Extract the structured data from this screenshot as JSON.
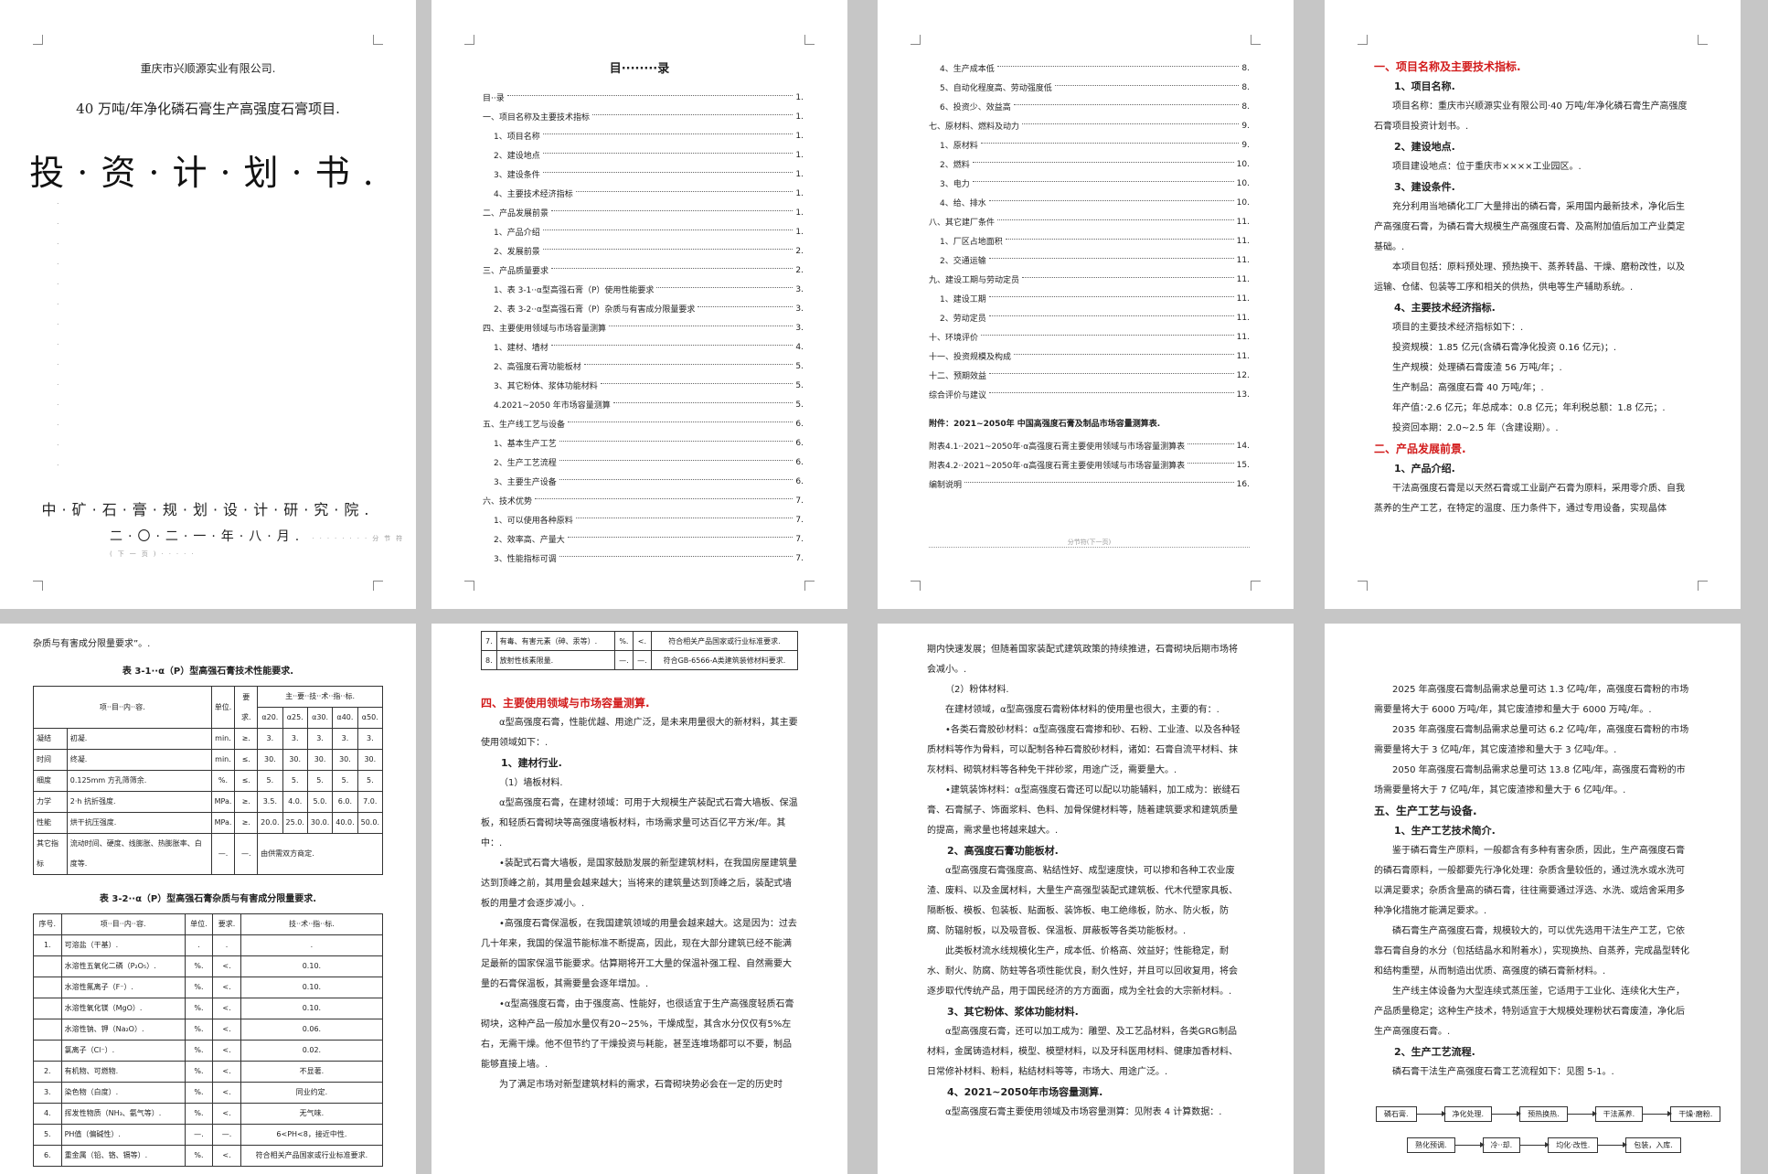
{
  "cover": {
    "company": "重庆市兴顺源实业有限公司.",
    "project": "40 万吨/年净化磷石膏生产高强度石膏项目.",
    "title": "投·资·计·划·书.",
    "institute": "中·矿·石·膏·规·划·设·计·研·究·院.",
    "date": "二·〇·二·一·年·八·月.",
    "section_break": "分节符(下一页)"
  },
  "toc": {
    "heading": "目········录",
    "page2_rows": [
      {
        "label": "目··录",
        "page": "1."
      },
      {
        "label": "一、项目名称及主要技术指标",
        "page": "1."
      },
      {
        "label": "1、项目名称",
        "page": "1."
      },
      {
        "label": "2、建设地点",
        "page": "1."
      },
      {
        "label": "3、建设条件",
        "page": "1."
      },
      {
        "label": "4、主要技术经济指标",
        "page": "1."
      },
      {
        "label": "二、产品发展前景",
        "page": "1."
      },
      {
        "label": "1、产品介绍",
        "page": "1."
      },
      {
        "label": "2、发展前景",
        "page": "2."
      },
      {
        "label": "三、产品质量要求",
        "page": "2."
      },
      {
        "label": "1、表 3-1··α型高强石膏（P）使用性能要求",
        "page": "3."
      },
      {
        "label": "2、表 3-2··α型高强石膏（P）杂质与有害成分限量要求",
        "page": "3."
      },
      {
        "label": "四、主要使用领域与市场容量测算",
        "page": "3."
      },
      {
        "label": "1、建材、墙材",
        "page": "4."
      },
      {
        "label": "2、高强度石膏功能板材",
        "page": "5."
      },
      {
        "label": "3、其它粉体、浆体功能材料",
        "page": "5."
      },
      {
        "label": "4.2021~2050 年市场容量测算",
        "page": "5."
      },
      {
        "label": "五、生产线工艺与设备",
        "page": "6."
      },
      {
        "label": "1、基本生产工艺",
        "page": "6."
      },
      {
        "label": "2、生产工艺流程",
        "page": "6."
      },
      {
        "label": "3、主要生产设备",
        "page": "6."
      },
      {
        "label": "六、技术优势",
        "page": "7."
      },
      {
        "label": "1、可以使用各种原料",
        "page": "7."
      },
      {
        "label": "2、效率高、产量大",
        "page": "7."
      },
      {
        "label": "3、性能指标可调",
        "page": "7."
      }
    ],
    "page3_rows": [
      {
        "label": "4、生产成本低",
        "page": "8."
      },
      {
        "label": "5、自动化程度高、劳动强度低",
        "page": "8."
      },
      {
        "label": "6、投资少、效益高",
        "page": "8."
      },
      {
        "label": "七、原材料、燃料及动力",
        "page": "9."
      },
      {
        "label": "1、原材料",
        "page": "9."
      },
      {
        "label": "2、燃料",
        "page": "10."
      },
      {
        "label": "3、电力",
        "page": "10."
      },
      {
        "label": "4、给、排水",
        "page": "10."
      },
      {
        "label": "八、其它建厂条件",
        "page": "11."
      },
      {
        "label": "1、厂区占地面积",
        "page": "11."
      },
      {
        "label": "2、交通运输",
        "page": "11."
      },
      {
        "label": "九、建设工期与劳动定员",
        "page": "11."
      },
      {
        "label": "1、建设工期",
        "page": "11."
      },
      {
        "label": "2、劳动定员",
        "page": "11."
      },
      {
        "label": "十、环境评价",
        "page": "11."
      },
      {
        "label": "十一、投资规模及构成",
        "page": "11."
      },
      {
        "label": "十二、预期效益",
        "page": "12."
      },
      {
        "label": "综合评价与建议",
        "page": "13."
      }
    ],
    "appendix_title": "附件：2021~2050年 中国高强度石膏及制品市场容量测算表.",
    "appendix_rows": [
      {
        "label": "附表4.1··2021~2050年·α高强度石膏主要使用领域与市场容量测算表",
        "page": "14."
      },
      {
        "label": "附表4.2··2021~2050年·α高强度石膏主要使用领域与市场容量测算表",
        "page": "15."
      },
      {
        "label": "编制说明",
        "page": "16."
      }
    ],
    "section_break": "分节符(下一页)"
  },
  "page4": {
    "h1": "一、项目名称及主要技术指标.",
    "s1": "1、项目名称.",
    "p1": "项目名称：重庆市兴顺源实业有限公司·40 万吨/年净化磷石膏生产高强度石膏项目投资计划书。.",
    "s2": "2、建设地点.",
    "p2": "项目建设地点：位于重庆市××××工业园区。.",
    "s3": "3、建设条件.",
    "p3": "充分利用当地磷化工厂大量排出的磷石膏，采用国内最新技术，净化后生产高强度石膏，为磷石膏大规模生产高强度石膏、及高附加值后加工产业奠定基础。.",
    "p4": "本项目包括：原料预处理、预热换干、蒸养转晶、干燥、磨粉改性，以及运输、仓储、包装等工序和相关的供热，供电等生产辅助系统。.",
    "s4": "4、主要技术经济指标.",
    "p5": "项目的主要技术经济指标如下：.",
    "l1": "投资规模：1.85 亿元(含磷石膏净化投资 0.16 亿元)；.",
    "l2": "生产规模：处理磷石膏废渣 56 万吨/年；.",
    "l3": "生产制品：高强度石膏 40 万吨/年；.",
    "l4": "年产值：·2.6 亿元；年总成本：0.8 亿元；年利税总额：1.8 亿元；.",
    "l5": "投资回本期：2.0~2.5 年（含建设期）。.",
    "h2": "二、产品发展前景.",
    "s5": "1、产品介绍.",
    "p6": "干法高强度石膏是以天然石膏或工业副产石膏为原料，采用零介质、自我蒸养的生产工艺，在特定的温度、压力条件下，通过专用设备，实现晶体"
  },
  "page5": {
    "intro": "杂质与有害成分限量要求”。.",
    "t1_title": "表 3-1··α（P）型高强石膏技术性能要求.",
    "t1_head": [
      "项··目··内··容.",
      "单位.",
      "要求.",
      "主··要··技··术··指··标."
    ],
    "t1_grades": [
      "α20.",
      "α25.",
      "α30.",
      "α40.",
      "α50."
    ],
    "t1_rows": [
      {
        "g": "凝结",
        "item": "初凝.",
        "unit": "min.",
        "req": "≥.",
        "v": [
          "3.",
          "3.",
          "3.",
          "3.",
          "3."
        ]
      },
      {
        "g": "时间",
        "item": "终凝.",
        "unit": "min.",
        "req": "≤.",
        "v": [
          "30.",
          "30.",
          "30.",
          "30.",
          "30."
        ]
      },
      {
        "g": "细度",
        "item": "0.125mm 方孔筛筛余.",
        "unit": "%.",
        "req": "≤.",
        "v": [
          "5.",
          "5.",
          "5.",
          "5.",
          "5."
        ]
      },
      {
        "g": "力学",
        "item": "2·h 抗折强度.",
        "unit": "MPa.",
        "req": "≥.",
        "v": [
          "3.5.",
          "4.0.",
          "5.0.",
          "6.0.",
          "7.0."
        ]
      },
      {
        "g": "性能",
        "item": "烘干抗压强度.",
        "unit": "MPa.",
        "req": "≥.",
        "v": [
          "20.0.",
          "25.0.",
          "30.0.",
          "40.0.",
          "50.0."
        ]
      },
      {
        "g": "其它指标",
        "item": "流动时间、硬度、线膨胀、热膨胀率、白度等.",
        "unit": "—.",
        "req": "—.",
        "v": [
          "由供需双方商定."
        ]
      }
    ],
    "t2_title": "表 3-2··α（P）型高强石膏杂质与有害成分限量要求.",
    "t2_head": [
      "序号.",
      "项··目··内··容.",
      "单位.",
      "要求.",
      "技··术··指··标."
    ],
    "t2_rows": [
      {
        "n": "1.",
        "item": "可溶盐（干基）.",
        "unit": ".",
        "req": ".",
        "val": "."
      },
      {
        "n": "",
        "item": "水溶性五氧化二磷（P₂O₅）.",
        "unit": "%.",
        "req": "<.",
        "val": "0.10."
      },
      {
        "n": "",
        "item": "水溶性氟离子（F⁻）.",
        "unit": "%.",
        "req": "<.",
        "val": "0.10."
      },
      {
        "n": "",
        "item": "水溶性氧化镁（MgO）.",
        "unit": "%.",
        "req": "<.",
        "val": "0.10."
      },
      {
        "n": "",
        "item": "水溶性钠、钾（Na₂O）.",
        "unit": "%.",
        "req": "<.",
        "val": "0.06."
      },
      {
        "n": "",
        "item": "氯离子（Cl⁻）.",
        "unit": "%.",
        "req": "<.",
        "val": "0.02."
      },
      {
        "n": "2.",
        "item": "有机物、可燃物.",
        "unit": "%.",
        "req": "<.",
        "val": "不显著."
      },
      {
        "n": "3.",
        "item": "染色物（白度）.",
        "unit": "%.",
        "req": "<.",
        "val": "同业约定."
      },
      {
        "n": "4.",
        "item": "挥发性物质（NH₃、氨气等）.",
        "unit": "%.",
        "req": "<.",
        "val": "无气味."
      },
      {
        "n": "5.",
        "item": "PH值（偏碱性）.",
        "unit": "—.",
        "req": "—.",
        "val": "6<PH<8，接近中性."
      },
      {
        "n": "6.",
        "item": "重金属（铅、铬、镉等）.",
        "unit": "%.",
        "req": "<.",
        "val": "符合相关产品国家或行业标准要求."
      }
    ]
  },
  "page6": {
    "tr7": {
      "n": "7.",
      "item": "有毒、有害元素（砷、汞等）.",
      "unit": "%.",
      "req": "<.",
      "val": "符合相关产品国家或行业标准要求."
    },
    "tr8": {
      "n": "8.",
      "item": "放射性核素限量.",
      "unit": "—.",
      "req": "—.",
      "val": "符合GB-6566-A类建筑装修材料要求."
    },
    "h1": "四、主要使用领域与市场容量测算.",
    "p1": "α型高强度石膏，性能优越、用途广泛，是未来用量很大的新材料，其主要使用领域如下：.",
    "s1": "1、建材行业.",
    "s1a": "（1）墙板材料.",
    "p2": "α型高强度石膏，在建材领域：可用于大规模生产装配式石膏大墙板、保温板，和轻质石膏砌块等高强度墙板材料，市场需求量可达百亿平方米/年。其中：.",
    "p3": "•装配式石膏大墙板，是国家鼓励发展的新型建筑材料，在我国房屋建筑量达到顶峰之前，其用量会越来越大；当将来的建筑量达到顶峰之后，装配式墙板的用量才会逐步减小。.",
    "p4": "•高强度石膏保温板，在我国建筑领域的用量会越来越大。这是因为：过去几十年来，我国的保温节能标准不断提高，因此，现在大部分建筑已经不能满足最新的国家保温节能要求。估算期将开工大量的保温补强工程、自然需要大量的石膏保温板，其需要量会逐年增加。.",
    "p5": "•α型高强度石膏，由于强度高、性能好，也很适宜于生产高强度轻质石膏砌块，这种产品一般加水量仅有20~25%，干燥成型，其含水分仅仅有5%左右，无需干燥。他不但节约了干燥投资与耗能，甚至连堆场都可以不要，制品能够直接上墙。.",
    "p6": "为了满足市场对新型建筑材料的需求，石膏砌块势必会在一定的历史时"
  },
  "page7": {
    "p1": "期内快速发展；但随着国家装配式建筑政策的持续推进，石膏砌块后期市场将会减小。.",
    "s1": "（2）粉体材料.",
    "p2": "在建材领域，α型高强度石膏粉体材料的使用量也很大，主要的有：.",
    "p3": "•各类石膏胶砂材料：α型高强度石膏掺和砂、石粉、工业渣、以及各种轻质材料等作为骨料，可以配制各种石膏胶砂材料，诸如：石膏自流平材料、抹灰材料、砌筑材料等各种免干拌砂浆，用途广泛，需要量大。.",
    "p4": "•建筑装饰材料：α型高强度石膏还可以配以功能辅料，加工成为：嵌缝石膏、石膏腻子、饰面浆料、色料、加骨保健材料等，随着建筑要求和建筑质量的提高，需求量也将越来越大。.",
    "s2": "2、高强度石膏功能板材.",
    "p5": "α型高强度石膏强度高、粘结性好、成型速度快，可以掺和各种工农业废渣、废料、以及金属材料，大量生产高强型装配式建筑板、代木代塑家具板、隔断板、模板、包装板、贴面板、装饰板、电工绝缘板，防水、防火板，防腐、防辐射板，以及吸音板、保温板、屏蔽板等各类功能板材。.",
    "p6": "此类板材流水线规模化生产，成本低、价格高、效益好；性能稳定，耐水、耐火、防腐、防蛀等各项性能优良，耐久性好，并且可以回收复用，将会逐步取代传统产品，用于国民经济的方方面面，成为全社会的大宗新材料。.",
    "s3": "3、其它粉体、浆体功能材料.",
    "p7": "α型高强度石膏，还可以加工成为：雕塑、及工艺品材料，各类GRG制品材料，金属铸造材料，模型、模塑材料，以及牙科医用材料、健康加香材料、日常修补材料、粉料，粘结材料等等，市场大、用途广泛。.",
    "s4": "4、2021~2050年市场容量测算.",
    "p8": "α型高强度石膏主要使用领域及市场容量测算：见附表 4 计算数据：."
  },
  "page8": {
    "p1": "2025 年高强度石膏制品需求总量可达 1.3 亿吨/年，高强度石膏粉的市场需要量将大于 6000 万吨/年，其它废渣掺和量大于 6000 万吨/年。.",
    "p2": "2035 年高强度石膏制品需求总量可达 6.2 亿吨/年，高强度石膏粉的市场需要量将大于 3 亿吨/年，其它废渣掺和量大于 3 亿吨/年。.",
    "p3": "2050 年高强度石膏制品需求总量可达 13.8 亿吨/年，高强度石膏粉的市场需要量将大于 7 亿吨/年，其它废渣掺和量大于 6 亿吨/年。.",
    "h1": "五、生产工艺与设备.",
    "s1": "1、生产工艺技术简介.",
    "p4": "鉴于磷石膏生产原料，一般都含有多种有害杂质，因此，生产高强度石膏的磷石膏原料，一般都要先行净化处理：杂质含量较低的，通过洗水或水洗可以满足要求；杂质含量高的磷石膏，往往需要通过浮选、水洗、或焙舍采用多种净化措施才能满足要求。.",
    "p5": "磷石膏生产高强度石膏，规模较大的，可以优先选用干法生产工艺，它依靠石膏自身的水分（包括结晶水和附着水），实现换热、自蒸养，完成晶型转化和结构重塑，从而制造出优质、高强度的磷石膏新材料。.",
    "p6": "生产线主体设备为大型连续式蒸压釜，它适用于工业化、连续化大生产，产品质量稳定；这种生产技术，特别适宜于大规模处理粉状石膏废渣，净化后生产高强度石膏。.",
    "s2": "2、生产工艺流程.",
    "p7": "磷石膏干法生产高强度石膏工艺流程如下：见图 5-1。.",
    "flow1": [
      "磷石膏.",
      "净化处理.",
      "预热换热.",
      "干法蒸养.",
      "干燥·磨粉."
    ],
    "flow2": [
      "熟化预调.",
      "冷··却.",
      "均化·改性.",
      "包装，入库."
    ]
  }
}
